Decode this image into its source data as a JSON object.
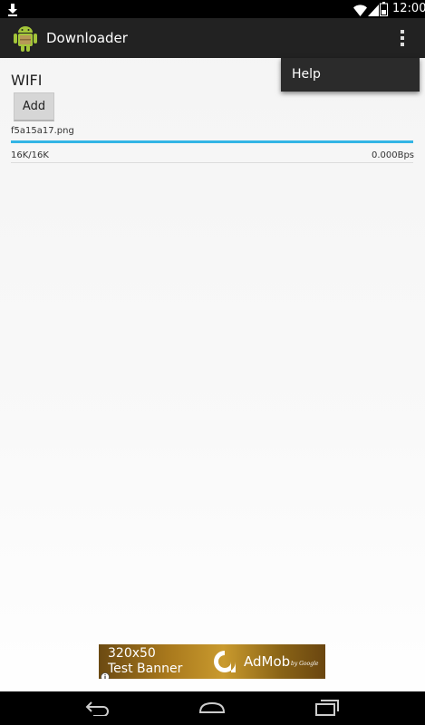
{
  "status_bar": {
    "time": "12:00",
    "icons": [
      "download-icon",
      "wifi-icon",
      "signal-icon",
      "battery-icon"
    ]
  },
  "action_bar": {
    "title": "Downloader",
    "app_icon": "android-icon",
    "overflow_icon": "more-vert-icon"
  },
  "overflow_menu": {
    "items": [
      {
        "label": "Help"
      }
    ]
  },
  "main": {
    "network_label": "WIFI",
    "add_button_label": "Add",
    "downloads": [
      {
        "file_name": "f5a15a17.png",
        "progress_fraction": 1.0,
        "size_text": "16K/16K",
        "speed_text": "0.000Bps"
      }
    ]
  },
  "ad_banner": {
    "size_text": "320x50",
    "label": "Test Banner",
    "brand": "AdMob",
    "brand_by": "by Google"
  },
  "nav_bar": {
    "buttons": [
      "back-icon",
      "home-icon",
      "recents-icon"
    ]
  },
  "colors": {
    "accent": "#33b5e5",
    "action_bar": "#222222",
    "status_bar": "#000000"
  }
}
